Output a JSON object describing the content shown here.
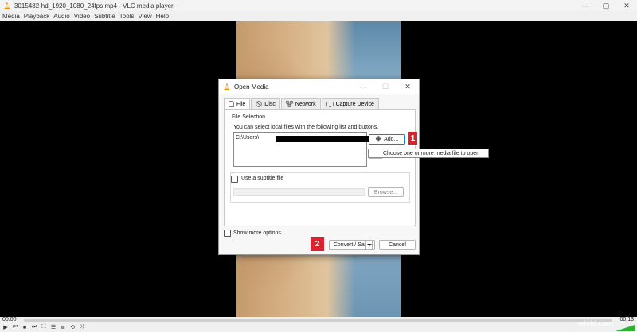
{
  "window": {
    "title": "3015482-hd_1920_1080_24fps.mp4 - VLC media player",
    "controls": {
      "minimize": "—",
      "maximize": "▢",
      "close": "✕"
    }
  },
  "menu": {
    "items": [
      "Media",
      "Playback",
      "Audio",
      "Video",
      "Subtitle",
      "Tools",
      "View",
      "Help"
    ]
  },
  "dialog": {
    "title": "Open Media",
    "controls": {
      "minimize": "—",
      "maximize": "☐",
      "close": "✕"
    },
    "tabs": [
      {
        "label": "File",
        "icon": "file-icon",
        "active": true
      },
      {
        "label": "Disc",
        "icon": "disc-icon",
        "active": false
      },
      {
        "label": "Network",
        "icon": "network-icon",
        "active": false
      },
      {
        "label": "Capture Device",
        "icon": "capture-device-icon",
        "active": false
      }
    ],
    "file_selection": {
      "group_label": "File Selection",
      "description": "You can select local files with the following list and buttons.",
      "file_entry": "C:\\Users\\",
      "ellipsis": "...",
      "add_label": "Add...",
      "tooltip": "Choose one or more media file to open"
    },
    "subtitle": {
      "checkbox_label": "Use a subtitle file",
      "browse_label": "Browse..."
    },
    "show_more": "Show more options",
    "convert_label": "Convert / Save",
    "cancel_label": "Cancel"
  },
  "badges": {
    "one": "1",
    "two": "2"
  },
  "player": {
    "time_elapsed": "00:00",
    "time_total": "00:13",
    "watermark": "wtvid.com"
  },
  "colors": {
    "badge": "#d9232e",
    "accent": "#1c7ccf",
    "vlc_orange": "#f48b00"
  }
}
